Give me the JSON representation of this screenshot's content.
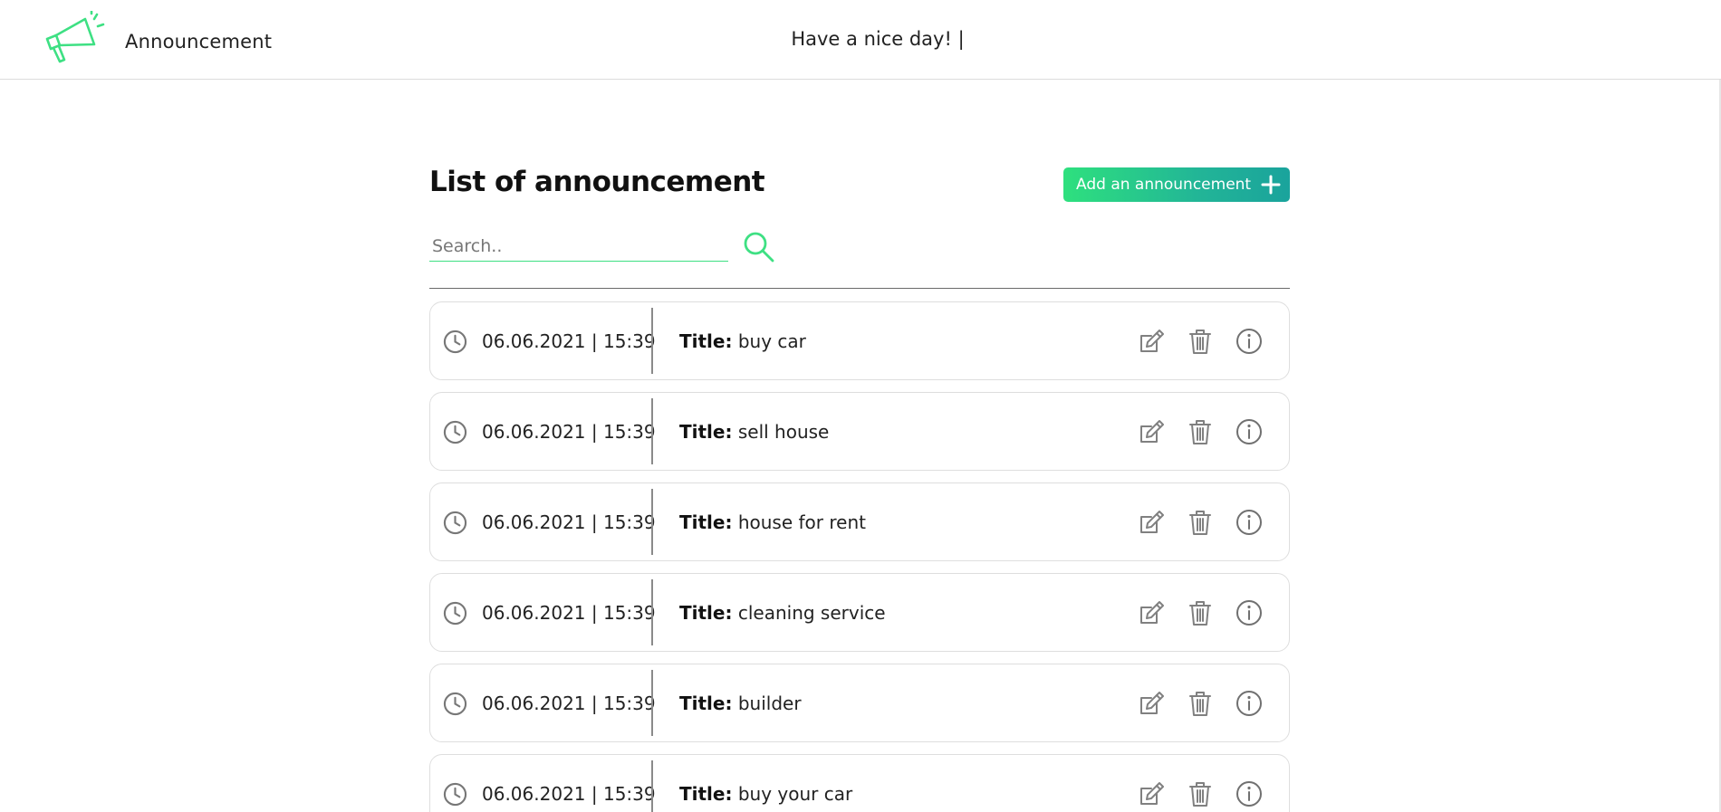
{
  "header": {
    "brand": "Announcement",
    "greeting": "Have a nice day! |",
    "logo_icon": "megaphone-icon"
  },
  "main": {
    "heading": "List of announcement",
    "add_button_label": "Add an announcement",
    "search_placeholder": "Search..",
    "search_value": ""
  },
  "announcements": [
    {
      "datetime": "06.06.2021 | 15:39",
      "title_label": "Title:",
      "title": "buy car"
    },
    {
      "datetime": "06.06.2021 | 15:39",
      "title_label": "Title:",
      "title": "sell house"
    },
    {
      "datetime": "06.06.2021 | 15:39",
      "title_label": "Title:",
      "title": "house for rent"
    },
    {
      "datetime": "06.06.2021 | 15:39",
      "title_label": "Title:",
      "title": "cleaning service"
    },
    {
      "datetime": "06.06.2021 | 15:39",
      "title_label": "Title:",
      "title": "builder"
    },
    {
      "datetime": "06.06.2021 | 15:39",
      "title_label": "Title:",
      "title": "buy your car"
    }
  ],
  "colors": {
    "accent_green": "#2ee07e",
    "accent_teal": "#1aa39c",
    "icon_gray": "#777777"
  }
}
